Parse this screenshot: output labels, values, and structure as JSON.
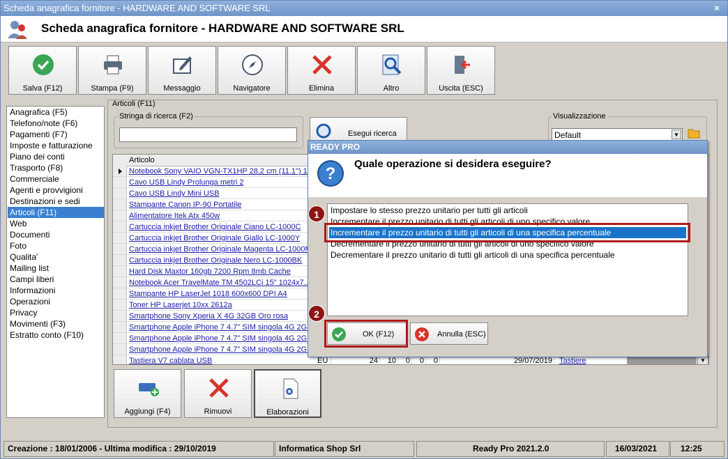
{
  "window": {
    "title": "Scheda anagrafica fornitore - HARDWARE AND SOFTWARE SRL",
    "close_glyph": "×"
  },
  "header": {
    "title": "Scheda anagrafica fornitore - HARDWARE AND SOFTWARE SRL",
    "icon": "users-icon"
  },
  "toolbar": {
    "buttons": [
      {
        "label": "Salva (F12)",
        "icon": "check-circle-icon"
      },
      {
        "label": "Stampa (F9)",
        "icon": "printer-icon"
      },
      {
        "label": "Messaggio",
        "icon": "message-edit-icon"
      },
      {
        "label": "Navigatore",
        "icon": "compass-icon"
      },
      {
        "label": "Elimina",
        "icon": "delete-x-icon"
      },
      {
        "label": "Altro",
        "icon": "search-document-icon"
      },
      {
        "label": "Uscita (ESC)",
        "icon": "exit-door-icon"
      }
    ]
  },
  "sidebar": {
    "items": [
      "Anagrafica (F5)",
      "Telefono/note (F6)",
      "Pagamenti (F7)",
      "Imposte e fatturazione",
      "Piano dei conti",
      "Trasporto (F8)",
      "Commerciale",
      "Agenti e provvigioni",
      "Destinazioni e sedi",
      "Articoli (F11)",
      "Web",
      "Documenti",
      "Foto",
      "Qualita'",
      "Mailing list",
      "Campi liberi",
      "Informazioni",
      "Operazioni",
      "Privacy",
      "Movimenti (F3)",
      "Estratto conto (F10)"
    ],
    "selected_index": 9
  },
  "articles": {
    "panel_title": "Articoli (F11)",
    "search_label": "Stringa di ricerca (F2)",
    "search_value": "",
    "search_button": "Esegui ricerca",
    "view_label": "Visualizzazione",
    "view_value": "Default",
    "column_header": "Articolo",
    "rows": [
      "Notebook Sony VAIO VGN-TX1HP 28,2 cm (11.1\") 1...",
      "Cavo USB Lindy Prolunga metri 2",
      "Cavo USB Lindy Mini USB",
      "Stampante Canon IP-90 Portatile",
      "Alimentatore Itek Atx 450w",
      "Cartuccia inkjet Brother Originale Ciano LC-1000C",
      "Cartuccia inkjet Brother Originale Giallo LC-1000Y",
      "Cartuccia inkjet Brother Originale Magenta LC-1000M",
      "Cartuccia inkjet Brother Originale Nero LC-1000BK",
      "Hard Disk Maxtor 160gb 7200 Rpm 8mb Cache",
      "Notebook Acer TravelMate TM 4502LCi 15\" 1024x7...",
      "Stampante HP LaserJet 1018 600x600 DPI A4",
      "Toner HP Laserjet 10xx 2612a",
      "Smartphone Sony Xperia X 4G 32GB Oro rosa",
      "Smartphone Apple iPhone 7 4.7\" SIM singola 4G 2G...",
      "Smartphone Apple iPhone 7 4.7\" SIM singola 4G 2G...",
      "Smartphone Apple iPhone 7 4.7\" SIM singola 4G 2G...",
      "Tastiera V7 cablata USB"
    ],
    "last_row_extra": {
      "unit": "EU",
      "v1": "24",
      "v2": "10",
      "v3": "0",
      "v4": "0",
      "v5": "0",
      "date": "29/07/2019",
      "category": "Tastiere"
    }
  },
  "bottom_buttons": [
    {
      "label": "Aggiungi (F4)",
      "icon": "add-card-icon"
    },
    {
      "label": "Rimuovi",
      "icon": "remove-x-icon"
    },
    {
      "label": "Elaborazioni",
      "icon": "gear-document-icon"
    }
  ],
  "dialog": {
    "title": "READY PRO",
    "question": "Quale operazione si desidera eseguire?",
    "options": [
      "Impostare lo stesso prezzo unitario per tutti gli articoli",
      "Incrementare il prezzo unitario di tutti gli articoli di uno specifico valore",
      "Incrementare il prezzo unitario di tutti gli articoli di una specifica percentuale",
      "Decrementare il prezzo unitario di tutti gli articoli di uno specifico valore",
      "Decrementare il prezzo unitario di tutti gli articoli di una specifica percentuale"
    ],
    "selected_index": 2,
    "ok_label": "OK (F12)",
    "cancel_label": "Annulla (ESC)",
    "callout_1": "1",
    "callout_2": "2"
  },
  "statusbar": {
    "dates": "Creazione : 18/01/2006 - Ultima modifica : 29/10/2019",
    "company": "Informatica Shop Srl",
    "version": "Ready Pro 2021.2.0",
    "date": "16/03/2021",
    "time": "12:25"
  },
  "colors": {
    "accent": "#3a7fd0",
    "callout": "#8e1414",
    "link": "#1a1aa6",
    "ok_green": "#3aa655",
    "delete_red": "#d9342b"
  }
}
